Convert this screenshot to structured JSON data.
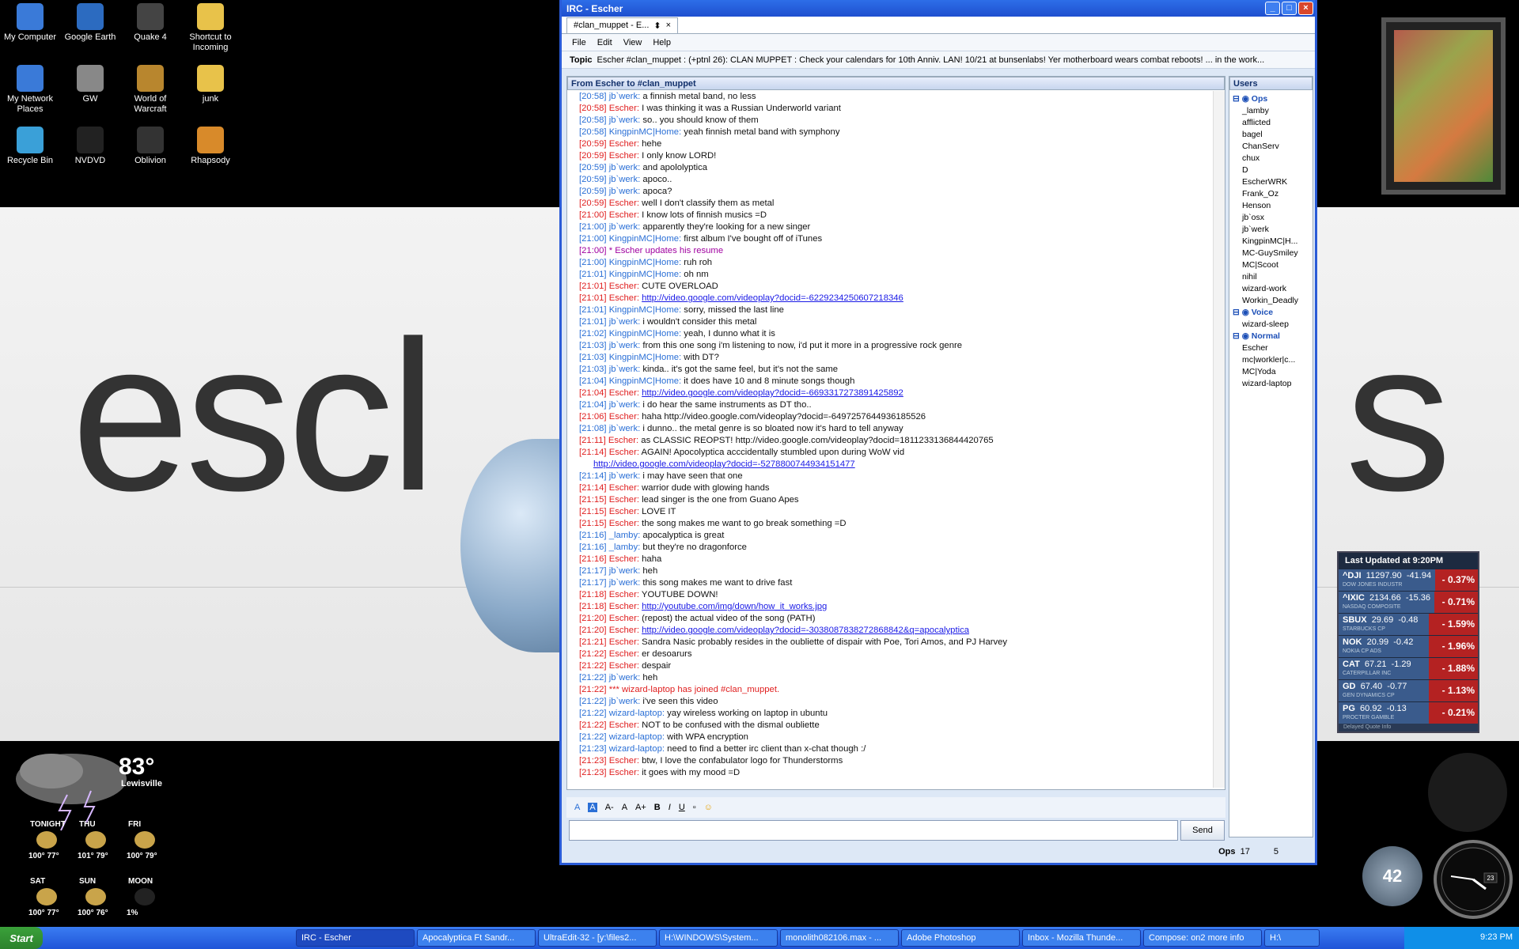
{
  "desktop": {
    "icons": [
      {
        "label": "My Computer"
      },
      {
        "label": "Google Earth"
      },
      {
        "label": "Quake 4"
      },
      {
        "label": "Shortcut to Incoming"
      },
      {
        "label": "My Network Places"
      },
      {
        "label": "GW"
      },
      {
        "label": "World of Warcraft"
      },
      {
        "label": "junk"
      },
      {
        "label": "Recycle Bin"
      },
      {
        "label": "NVDVD"
      },
      {
        "label": "Oblivion"
      },
      {
        "label": "Rhapsody"
      }
    ],
    "wallpaper_text_left": "escl",
    "wallpaper_text_right": "s"
  },
  "window": {
    "title": "IRC - Escher",
    "tab_label": "#clan_muppet - E...",
    "menu": [
      "File",
      "Edit",
      "View",
      "Help"
    ],
    "topic_label": "Topic",
    "topic": "Escher #clan_muppet : (+ptnl 26): CLAN MUPPET : Check your calendars for 10th Anniv. LAN!  10/21 at bunsenlabs! Yer motherboard wears combat reboots! ... in the work...",
    "chat_header": "From Escher to #clan_muppet",
    "users_header": "Users",
    "send_label": "Send",
    "status_ops_label": "Ops",
    "status_ops": "17",
    "status_count": "5"
  },
  "chat": [
    {
      "t": "[20:58]",
      "n": "jb`werk:",
      "m": "a finnish metal band, no less",
      "c": "blue"
    },
    {
      "t": "[20:58]",
      "n": "Escher:",
      "m": "I was thinking it was a Russian Underworld variant",
      "c": "red"
    },
    {
      "t": "[20:58]",
      "n": "jb`werk:",
      "m": "so.. you should know of them",
      "c": "blue"
    },
    {
      "t": "[20:58]",
      "n": "KingpinMC|Home:",
      "m": "yeah finnish metal band with symphony",
      "c": "blue"
    },
    {
      "t": "[20:59]",
      "n": "Escher:",
      "m": "hehe",
      "c": "red"
    },
    {
      "t": "[20:59]",
      "n": "Escher:",
      "m": "I only know LORD!",
      "c": "red"
    },
    {
      "t": "[20:59]",
      "n": "jb`werk:",
      "m": "and apololyptica",
      "c": "blue"
    },
    {
      "t": "[20:59]",
      "n": "jb`werk:",
      "m": "apoco..",
      "c": "blue"
    },
    {
      "t": "[20:59]",
      "n": "jb`werk:",
      "m": "apoca?",
      "c": "blue"
    },
    {
      "t": "[20:59]",
      "n": "Escher:",
      "m": "well I don't classify them as metal",
      "c": "red"
    },
    {
      "t": "[21:00]",
      "n": "Escher:",
      "m": "I know lots of finnish musics =D",
      "c": "red"
    },
    {
      "t": "[21:00]",
      "n": "jb`werk:",
      "m": "apparently they're looking for a new singer",
      "c": "blue"
    },
    {
      "t": "[21:00]",
      "n": "KingpinMC|Home:",
      "m": "first album I've bought off of iTunes",
      "c": "blue"
    },
    {
      "t": "[21:00]",
      "n": "* Escher",
      "m": "updates his resume",
      "c": "purple"
    },
    {
      "t": "[21:00]",
      "n": "KingpinMC|Home:",
      "m": "ruh roh",
      "c": "blue"
    },
    {
      "t": "[21:01]",
      "n": "KingpinMC|Home:",
      "m": "oh nm",
      "c": "blue"
    },
    {
      "t": "[21:01]",
      "n": "Escher:",
      "m": "CUTE OVERLOAD",
      "c": "red"
    },
    {
      "t": "[21:01]",
      "n": "Escher:",
      "m": "http://video.google.com/videoplay?docid=-6229234250607218346",
      "c": "red",
      "link": true
    },
    {
      "t": "[21:01]",
      "n": "KingpinMC|Home:",
      "m": "sorry, missed the last line",
      "c": "blue"
    },
    {
      "t": "[21:01]",
      "n": "jb`werk:",
      "m": "i wouldn't consider this metal",
      "c": "blue"
    },
    {
      "t": "[21:02]",
      "n": "KingpinMC|Home:",
      "m": "yeah, I dunno what it is",
      "c": "blue"
    },
    {
      "t": "[21:03]",
      "n": "jb`werk:",
      "m": "from this one song i'm listening to now, i'd put it more in a progressive rock genre",
      "c": "blue"
    },
    {
      "t": "[21:03]",
      "n": "KingpinMC|Home:",
      "m": "with DT?",
      "c": "blue"
    },
    {
      "t": "[21:03]",
      "n": "jb`werk:",
      "m": "kinda.. it's got the same feel, but it's not the same",
      "c": "blue"
    },
    {
      "t": "[21:04]",
      "n": "KingpinMC|Home:",
      "m": "it does have 10 and 8 minute songs though",
      "c": "blue"
    },
    {
      "t": "[21:04]",
      "n": "Escher:",
      "m": "http://video.google.com/videoplay?docid=-6693317273891425892",
      "c": "red",
      "link": true
    },
    {
      "t": "[21:04]",
      "n": "jb`werk:",
      "m": "i do hear the same instruments as DT tho..",
      "c": "blue"
    },
    {
      "t": "[21:06]",
      "n": "Escher:",
      "m": "haha http://video.google.com/videoplay?docid=-6497257644936185526",
      "c": "red"
    },
    {
      "t": "[21:08]",
      "n": "jb`werk:",
      "m": "i dunno.. the metal genre is so bloated now it's hard to tell anyway",
      "c": "blue"
    },
    {
      "t": "[21:11]",
      "n": "Escher:",
      "m": "as CLASSIC REOPST! http://video.google.com/videoplay?docid=1811233136844420765",
      "c": "red"
    },
    {
      "t": "[21:14]",
      "n": "Escher:",
      "m": "AGAIN! Apocolyptica acccidentally stumbled upon during WoW vid",
      "c": "red"
    },
    {
      "t": "",
      "n": "",
      "m": "http://video.google.com/videoplay?docid=-5278800744934151477",
      "c": "red",
      "link": true
    },
    {
      "t": "[21:14]",
      "n": "jb`werk:",
      "m": "i may have seen that one",
      "c": "blue"
    },
    {
      "t": "[21:14]",
      "n": "Escher:",
      "m": "warrior dude with glowing hands",
      "c": "red"
    },
    {
      "t": "[21:15]",
      "n": "Escher:",
      "m": "lead singer is the one from Guano Apes",
      "c": "red"
    },
    {
      "t": "[21:15]",
      "n": "Escher:",
      "m": "LOVE IT",
      "c": "red"
    },
    {
      "t": "[21:15]",
      "n": "Escher:",
      "m": "the song makes me want to go break something =D",
      "c": "red"
    },
    {
      "t": "[21:16]",
      "n": "_lamby:",
      "m": "apocalyptica is great",
      "c": "blue"
    },
    {
      "t": "[21:16]",
      "n": "_lamby:",
      "m": "but they're no dragonforce",
      "c": "blue"
    },
    {
      "t": "[21:16]",
      "n": "Escher:",
      "m": "haha",
      "c": "red"
    },
    {
      "t": "[21:17]",
      "n": "jb`werk:",
      "m": "heh",
      "c": "blue"
    },
    {
      "t": "[21:17]",
      "n": "jb`werk:",
      "m": "this song makes me want to drive fast",
      "c": "blue"
    },
    {
      "t": "[21:18]",
      "n": "Escher:",
      "m": "YOUTUBE DOWN!",
      "c": "red"
    },
    {
      "t": "[21:18]",
      "n": "Escher:",
      "m": "http://youtube.com/img/down/how_it_works.jpg",
      "c": "red",
      "link": true
    },
    {
      "t": "[21:20]",
      "n": "Escher:",
      "m": "(repost) the actual video of the song (PATH)",
      "c": "red"
    },
    {
      "t": "[21:20]",
      "n": "Escher:",
      "m": "http://video.google.com/videoplay?docid=-3038087838272868842&q=apocalyptica",
      "c": "red",
      "link": true
    },
    {
      "t": "[21:21]",
      "n": "Escher:",
      "m": "Sandra Nasic probably resides in the oubliette of dispair with Poe, Tori Amos, and PJ Harvey",
      "c": "red"
    },
    {
      "t": "[21:22]",
      "n": "Escher:",
      "m": " er desoarurs",
      "c": "red"
    },
    {
      "t": "[21:22]",
      "n": "Escher:",
      "m": "despair",
      "c": "red"
    },
    {
      "t": "[21:22]",
      "n": "jb`werk:",
      "m": "heh",
      "c": "blue"
    },
    {
      "t": "[21:22]",
      "n": "*** wizard-laptop",
      "m": "has joined #clan_muppet.",
      "c": "join"
    },
    {
      "t": "[21:22]",
      "n": "jb`werk:",
      "m": "i've seen this video",
      "c": "blue"
    },
    {
      "t": "[21:22]",
      "n": "wizard-laptop:",
      "m": "yay wireless working on laptop in ubuntu",
      "c": "blue"
    },
    {
      "t": "[21:22]",
      "n": "Escher:",
      "m": "NOT to be confused with the dismal oubliette",
      "c": "red"
    },
    {
      "t": "[21:22]",
      "n": "wizard-laptop:",
      "m": "with WPA encryption",
      "c": "blue"
    },
    {
      "t": "[21:23]",
      "n": "wizard-laptop:",
      "m": "need to find a better irc client than x-chat though :/",
      "c": "blue"
    },
    {
      "t": "[21:23]",
      "n": "Escher:",
      "m": "btw, I love the confabulator logo for Thunderstorms",
      "c": "red"
    },
    {
      "t": "[21:23]",
      "n": "Escher:",
      "m": "it goes with my mood =D",
      "c": "red"
    }
  ],
  "users": {
    "ops_label": "Ops",
    "ops": [
      "_lamby",
      "afflicted",
      "bagel",
      "ChanServ",
      "chux",
      "D",
      "EscherWRK",
      "Frank_Oz",
      "Henson",
      "jb`osx",
      "jb`werk",
      "KingpinMC|H...",
      "MC-GuySmiley",
      "MC|Scoot",
      "nihil",
      "wizard-work",
      "Workin_Deadly"
    ],
    "voice_label": "Voice",
    "voice": [
      "wizard-sleep"
    ],
    "normal_label": "Normal",
    "normal": [
      "Escher",
      "mc|workler|c...",
      "MC|Yoda",
      "wizard-laptop"
    ]
  },
  "stocks": {
    "header": "Last Updated at 9:20PM",
    "rows": [
      {
        "sym": "^DJI",
        "price": "11297.90",
        "chg": "-41.94",
        "name": "DOW JONES INDUSTR",
        "pct": "- 0.37%"
      },
      {
        "sym": "^IXIC",
        "price": "2134.66",
        "chg": "-15.36",
        "name": "NASDAQ COMPOSITE",
        "pct": "- 0.71%"
      },
      {
        "sym": "SBUX",
        "price": "29.69",
        "chg": "-0.48",
        "name": "STARBUCKS CP",
        "pct": "- 1.59%"
      },
      {
        "sym": "NOK",
        "price": "20.99",
        "chg": "-0.42",
        "name": "NOKIA CP ADS",
        "pct": "- 1.96%"
      },
      {
        "sym": "CAT",
        "price": "67.21",
        "chg": "-1.29",
        "name": "CATERPILLAR INC",
        "pct": "- 1.88%"
      },
      {
        "sym": "GD",
        "price": "67.40",
        "chg": "-0.77",
        "name": "GEN DYNAMICS CP",
        "pct": "- 1.13%"
      },
      {
        "sym": "PG",
        "price": "60.92",
        "chg": "-0.13",
        "name": "PROCTER GAMBLE",
        "pct": "- 0.21%"
      }
    ],
    "footer": "Delayed Quote Info"
  },
  "weather": {
    "temp": "83°",
    "city": "Lewisville",
    "days": [
      {
        "d": "TONIGHT",
        "t": "100° 77°"
      },
      {
        "d": "THU",
        "t": "101° 79°"
      },
      {
        "d": "FRI",
        "t": "100° 79°"
      },
      {
        "d": "SAT",
        "t": "100° 77°"
      },
      {
        "d": "SUN",
        "t": "100° 76°"
      },
      {
        "d": "MOON",
        "t": "1%"
      }
    ]
  },
  "gauge_value": "42",
  "clock_date": "23",
  "taskbar": {
    "start": "Start",
    "items": [
      "IRC - Escher",
      "Apocalyptica Ft Sandr...",
      "UltraEdit-32 - [y:\\files2...",
      "H:\\WINDOWS\\System...",
      "monolith082106.max - ...",
      "Adobe Photoshop",
      "Inbox - Mozilla Thunde...",
      "Compose: on2 more info",
      "H:\\"
    ],
    "time": "9:23 PM"
  },
  "colors": {
    "nick_blue": "#2a6fd6",
    "nick_red": "#e02020",
    "purple": "#a000a0",
    "link": "#1a1ae6"
  }
}
